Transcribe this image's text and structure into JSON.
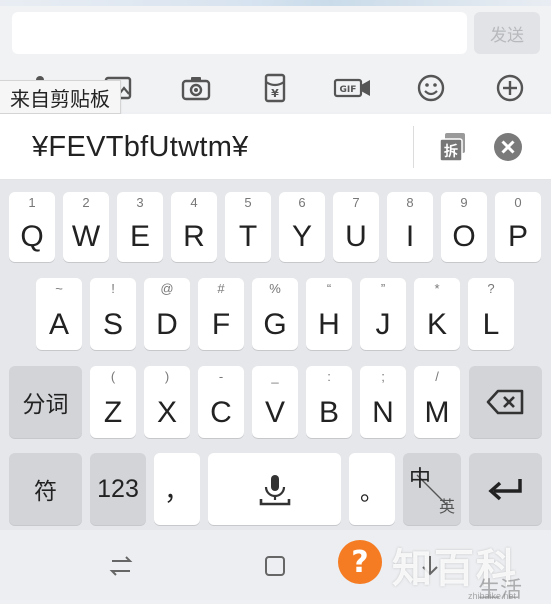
{
  "send_button": "发送",
  "clipboard_label": "来自剪贴板",
  "clipboard_text": "¥FEVTbfUtwtm¥",
  "split_label": "拆",
  "gif_label": "GIF",
  "toolbar_icons": [
    "mic-icon",
    "image-icon",
    "camera-icon",
    "red-packet-icon",
    "gif-icon",
    "emoji-icon",
    "plus-icon"
  ],
  "row1": [
    {
      "hint": "1",
      "label": "Q"
    },
    {
      "hint": "2",
      "label": "W"
    },
    {
      "hint": "3",
      "label": "E"
    },
    {
      "hint": "4",
      "label": "R"
    },
    {
      "hint": "5",
      "label": "T"
    },
    {
      "hint": "6",
      "label": "Y"
    },
    {
      "hint": "7",
      "label": "U"
    },
    {
      "hint": "8",
      "label": "I"
    },
    {
      "hint": "9",
      "label": "O"
    },
    {
      "hint": "0",
      "label": "P"
    }
  ],
  "row2": [
    {
      "hint": "~",
      "label": "A"
    },
    {
      "hint": "!",
      "label": "S"
    },
    {
      "hint": "@",
      "label": "D"
    },
    {
      "hint": "#",
      "label": "F"
    },
    {
      "hint": "%",
      "label": "G"
    },
    {
      "hint": "“",
      "label": "H"
    },
    {
      "hint": "”",
      "label": "J"
    },
    {
      "hint": "*",
      "label": "K"
    },
    {
      "hint": "?",
      "label": "L"
    }
  ],
  "row3": [
    {
      "hint": "(",
      "label": "Z"
    },
    {
      "hint": ")",
      "label": "X"
    },
    {
      "hint": "-",
      "label": "C"
    },
    {
      "hint": "_",
      "label": "V"
    },
    {
      "hint": ":",
      "label": "B"
    },
    {
      "hint": ";",
      "label": "N"
    },
    {
      "hint": "/",
      "label": "M"
    }
  ],
  "fenci_label": "分词",
  "symbol_label": "符",
  "num_label": "123",
  "comma_label": "，",
  "period_label": "。",
  "lang_main": "中",
  "lang_sub": "英",
  "watermark_text": "知百科",
  "watermark_sub": "生活",
  "watermark_url": "zhibaike.net"
}
